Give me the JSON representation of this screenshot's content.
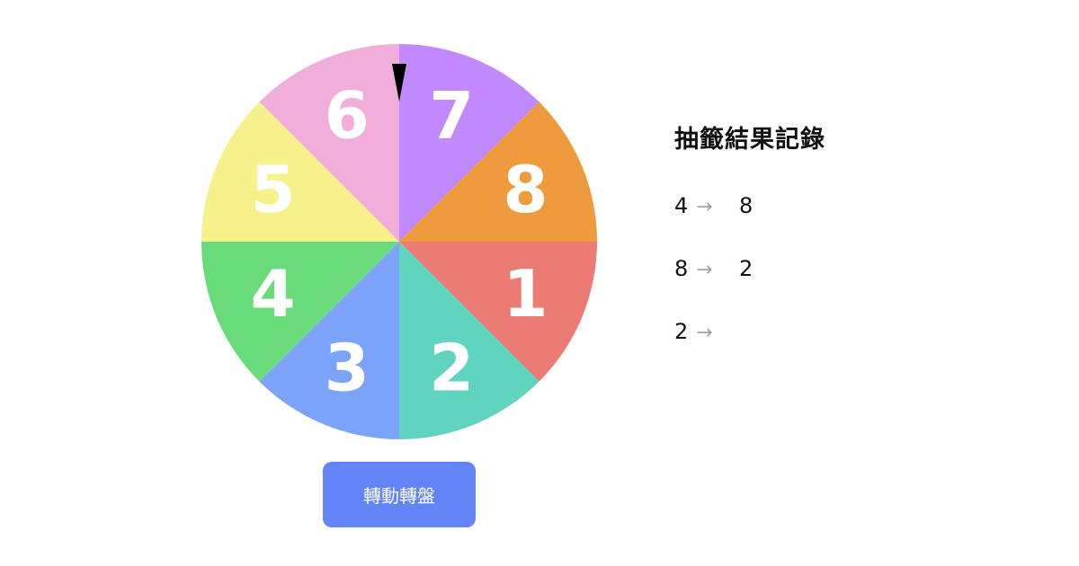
{
  "wheel": {
    "segments": [
      {
        "label": "1",
        "color": "#EC7B74"
      },
      {
        "label": "2",
        "color": "#60D4BF"
      },
      {
        "label": "3",
        "color": "#7BA3FA"
      },
      {
        "label": "4",
        "color": "#68DB7A"
      },
      {
        "label": "5",
        "color": "#F7F18C"
      },
      {
        "label": "6",
        "color": "#F2AEDA"
      },
      {
        "label": "7",
        "color": "#C189FD"
      },
      {
        "label": "8",
        "color": "#EE9B3E"
      }
    ],
    "pointer_color": "#000000"
  },
  "spin_button": {
    "label": "轉動轉盤",
    "color": "#6384F7"
  },
  "history": {
    "title": "抽籤結果記錄",
    "arrow": "→",
    "items": [
      {
        "from": "4",
        "to": "8"
      },
      {
        "from": "8",
        "to": "2"
      },
      {
        "from": "2",
        "to": ""
      }
    ]
  }
}
